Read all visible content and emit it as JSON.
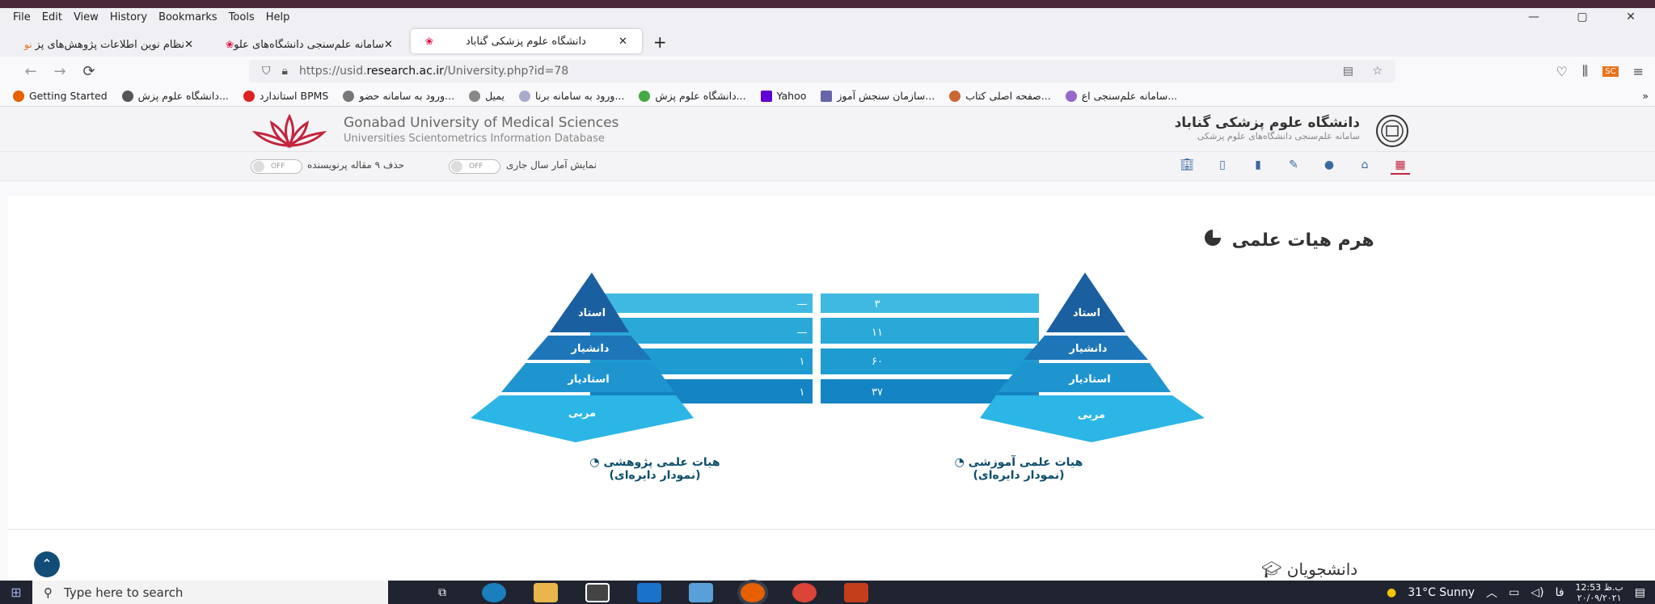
{
  "menu": [
    "File",
    "Edit",
    "View",
    "History",
    "Bookmarks",
    "Tools",
    "Help"
  ],
  "window_controls": [
    "—",
    "▢",
    "✕"
  ],
  "tabs": [
    {
      "label": "نظام نوین اطلاعات پژوهش‌های پز",
      "badge": "نو",
      "active": false
    },
    {
      "label": "سامانه علم‌سنجی دانشگاه‌های علو",
      "active": false
    },
    {
      "label": "دانشگاه علوم پزشکی گناباد",
      "active": true
    }
  ],
  "new_tab": "+",
  "nav": {
    "back": "←",
    "forward": "→",
    "reload": "⟳"
  },
  "url": {
    "prefix": "https://usid.",
    "domain": "research.ac.ir",
    "suffix": "/University.php?id=78"
  },
  "bookmarks": [
    "Getting Started",
    "دانشگاه علوم پزش...",
    "استاندارد BPMS",
    "ورود به سامانه حضو...",
    "یمیل",
    "ورود به سامانه برنا...",
    "دانشگاه علوم پزش...",
    "Yahoo",
    "سازمان سنجش آموز...",
    "صفحه اصلی کتاب...",
    "سامانه علم‌سنجی اع..."
  ],
  "site": {
    "name_en": "Gonabad University of Medical Sciences",
    "subtitle_en": "Universities Scientometrics Information Database",
    "name_fa": "دانشگاه علوم پزشکی گناباد",
    "subtitle_fa": "سامانه علم‌سنجی دانشگاه‌های علوم پزشکی"
  },
  "toggles": [
    {
      "label": "حذف ۹ مقاله پرنویسنده",
      "state": "OFF"
    },
    {
      "label": "نمایش آمار سال جاری",
      "state": "OFF"
    }
  ],
  "section_faculty": "هرم هیات علمی",
  "section_students": "دانشجویان",
  "pyramid": {
    "levels": [
      "استاد",
      "دانشیار",
      "استادیار",
      "مربی"
    ],
    "teaching_values": [
      "۳",
      "۱۱",
      "۶۰",
      "۳۷"
    ],
    "research_values": [
      "—",
      "—",
      "۱",
      "۱"
    ]
  },
  "captions": {
    "teaching": {
      "line1": "هیات علمی آموزشی",
      "line2": "(نمودار دایره‌ای)"
    },
    "research": {
      "line1": "هیات علمی پژوهشی",
      "line2": "(نمودار دایره‌ای)"
    }
  },
  "taskbar": {
    "search_placeholder": "Type here to search",
    "weather": "31°C  Sunny",
    "lang": "فا",
    "time": "12:53 ب.ظ",
    "date": "۲۰/۰۹/۲۰۲۱"
  },
  "colors": {
    "accent": "#c3243d",
    "pyramid_dark": "#1a5fa0",
    "pyramid_light": "#2bb6e6"
  }
}
